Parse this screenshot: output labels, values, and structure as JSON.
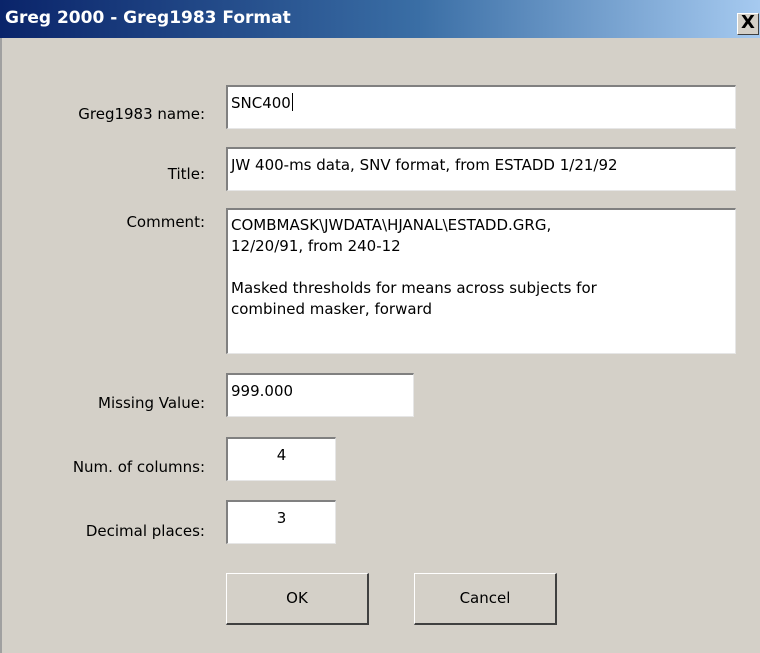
{
  "window": {
    "title": "Greg 2000 - Greg1983 Format",
    "close_glyph": "X"
  },
  "form": {
    "name_label": "Greg1983 name:",
    "name_value": "SNC400",
    "title_label": "Title:",
    "title_value": "JW 400-ms data, SNV format, from ESTADD 1/21/92",
    "comment_label": "Comment:",
    "comment_lines": [
      "COMBMASK\\JWDATA\\HJANAL\\ESTADD.GRG,",
      "12/20/91, from 240-12",
      "",
      "Masked thresholds for means across subjects for",
      "combined masker, forward"
    ],
    "missing_label": "Missing Value:",
    "missing_value": "999.000",
    "columns_label": "Num. of columns:",
    "columns_value": "4",
    "decimals_label": "Decimal places:",
    "decimals_value": "3"
  },
  "buttons": {
    "ok": "OK",
    "cancel": "Cancel"
  },
  "icons": {
    "close": "close-icon"
  },
  "colors": {
    "titlebar_start": "#0a246a",
    "titlebar_end": "#a6caf0",
    "dialog_bg": "#d4d0c8"
  }
}
